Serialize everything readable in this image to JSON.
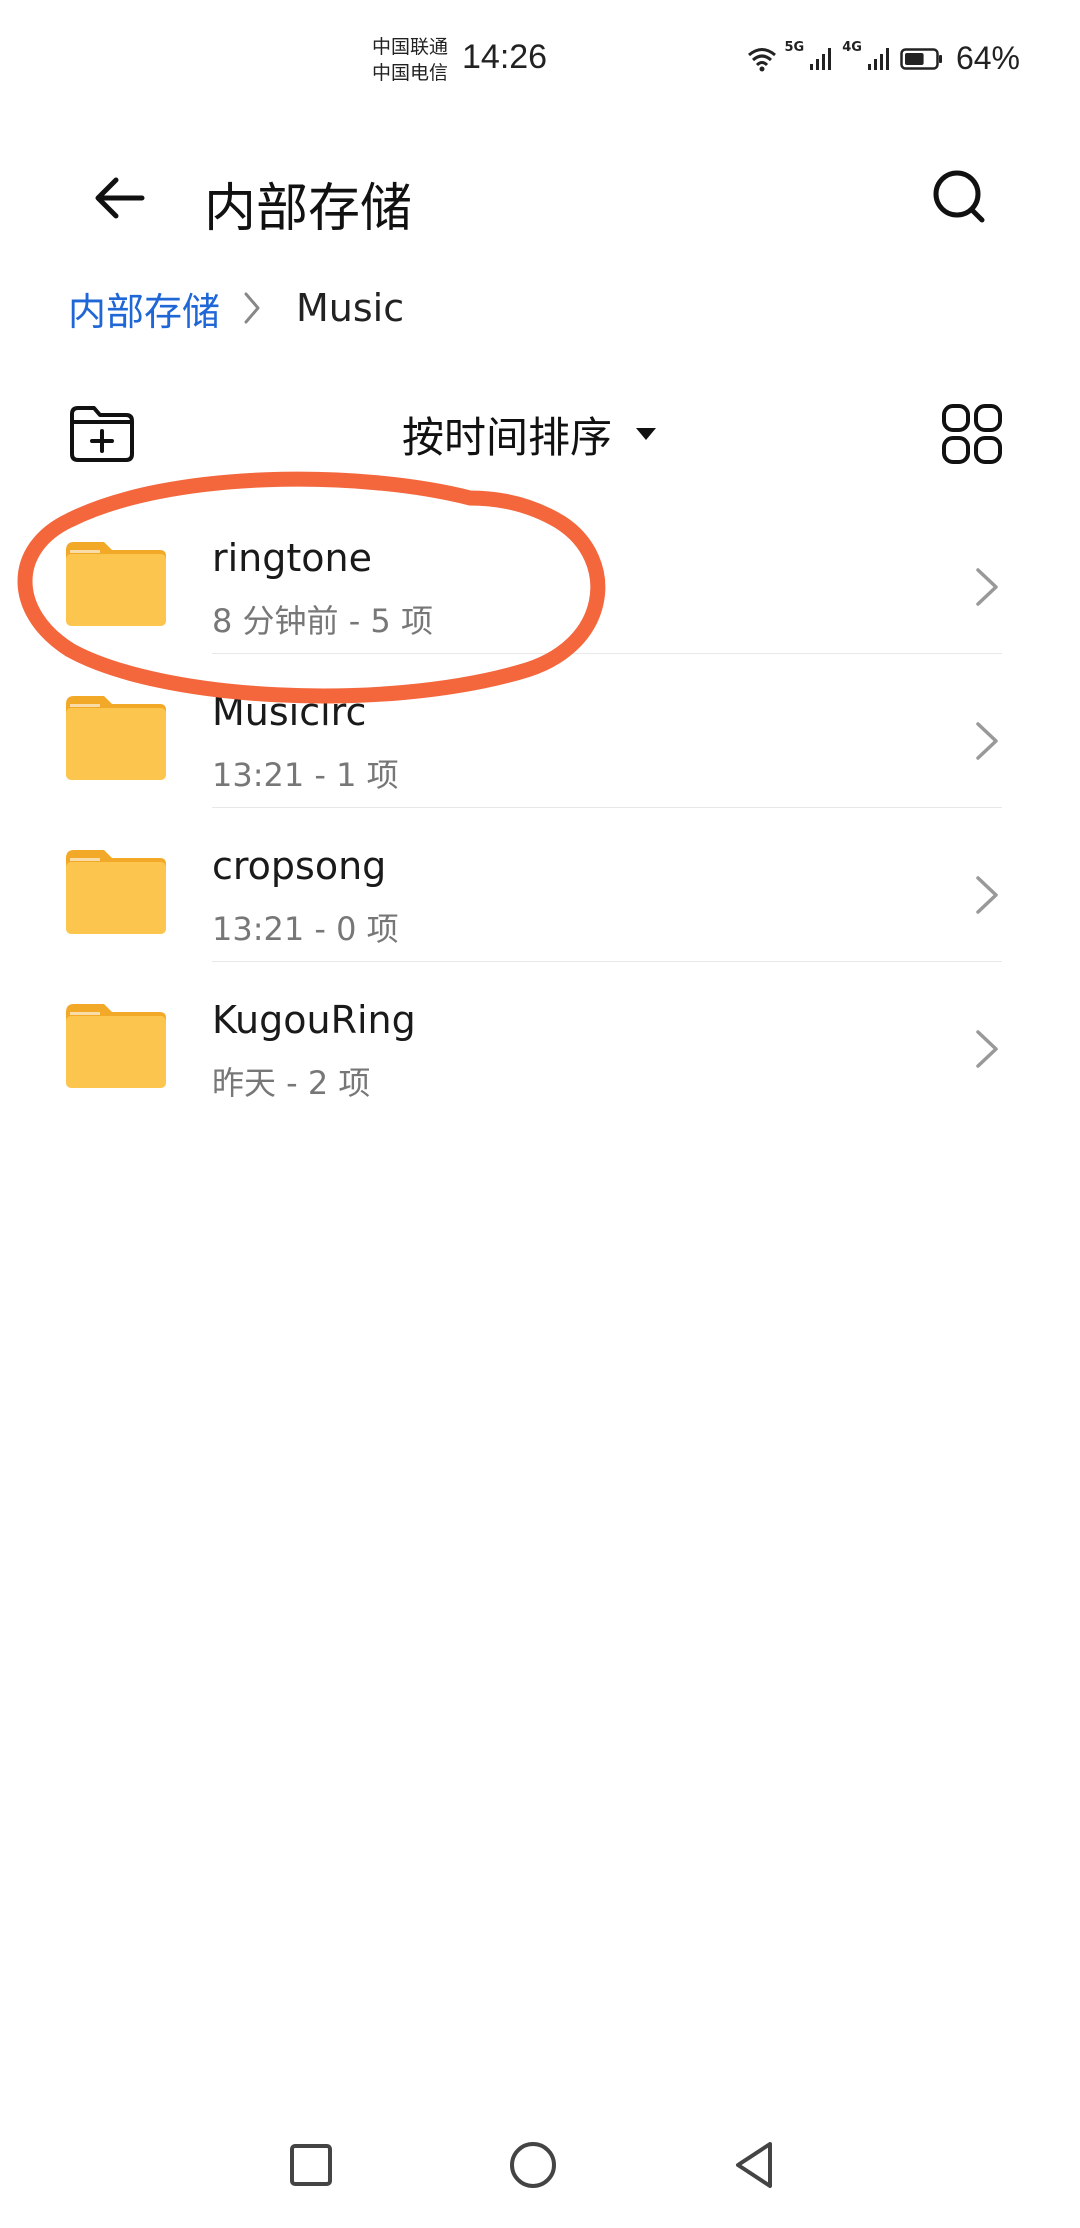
{
  "status_bar": {
    "carrier_1": "中国联通",
    "carrier_2": "中国电信",
    "time": "14:26",
    "net_1": "5G",
    "net_2": "4G",
    "battery": "64%",
    "battery_level": 0.64,
    "icons": [
      "wifi-icon",
      "signal-icon",
      "signal-icon",
      "battery-icon"
    ]
  },
  "header": {
    "title": "内部存储",
    "back_icon": "back-arrow-icon",
    "search_icon": "search-icon"
  },
  "breadcrumb": {
    "root": "内部存储",
    "current": "Music"
  },
  "toolbar": {
    "new_folder_icon": "new-folder-icon",
    "sort_label": "按时间排序",
    "view_icon": "grid-view-icon"
  },
  "files": [
    {
      "name": "ringtone",
      "meta": "8 分钟前 - 5 项"
    },
    {
      "name": "Musiclrc",
      "meta": "13:21 - 1 项"
    },
    {
      "name": "cropsong",
      "meta": "13:21 - 0 项"
    },
    {
      "name": "KugouRing",
      "meta": "昨天 - 2 项"
    }
  ],
  "colors": {
    "accent": "#1f66d6",
    "folder": "#fcc54e",
    "folder_tab": "#f3a928",
    "annotation": "#f4663c"
  }
}
